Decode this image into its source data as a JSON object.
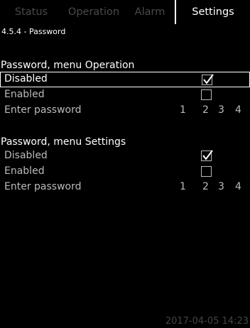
{
  "tabs": [
    {
      "label": "Status"
    },
    {
      "label": "Operation"
    },
    {
      "label": "Alarm"
    },
    {
      "label": "Settings"
    }
  ],
  "breadcrumb": "4.5.4 - Password",
  "sections": [
    {
      "title": "Password, menu Operation",
      "options": [
        {
          "label": "Disabled",
          "checked": true
        },
        {
          "label": "Enabled",
          "checked": false
        }
      ],
      "password_label": "Enter password",
      "digits": [
        "1",
        "2",
        "3",
        "4"
      ]
    },
    {
      "title": "Password, menu Settings",
      "options": [
        {
          "label": "Disabled",
          "checked": true
        },
        {
          "label": "Enabled",
          "checked": false
        }
      ],
      "password_label": "Enter password",
      "digits": [
        "1",
        "2",
        "3",
        "4"
      ]
    }
  ],
  "timestamp": "2017-04-05 14:23"
}
